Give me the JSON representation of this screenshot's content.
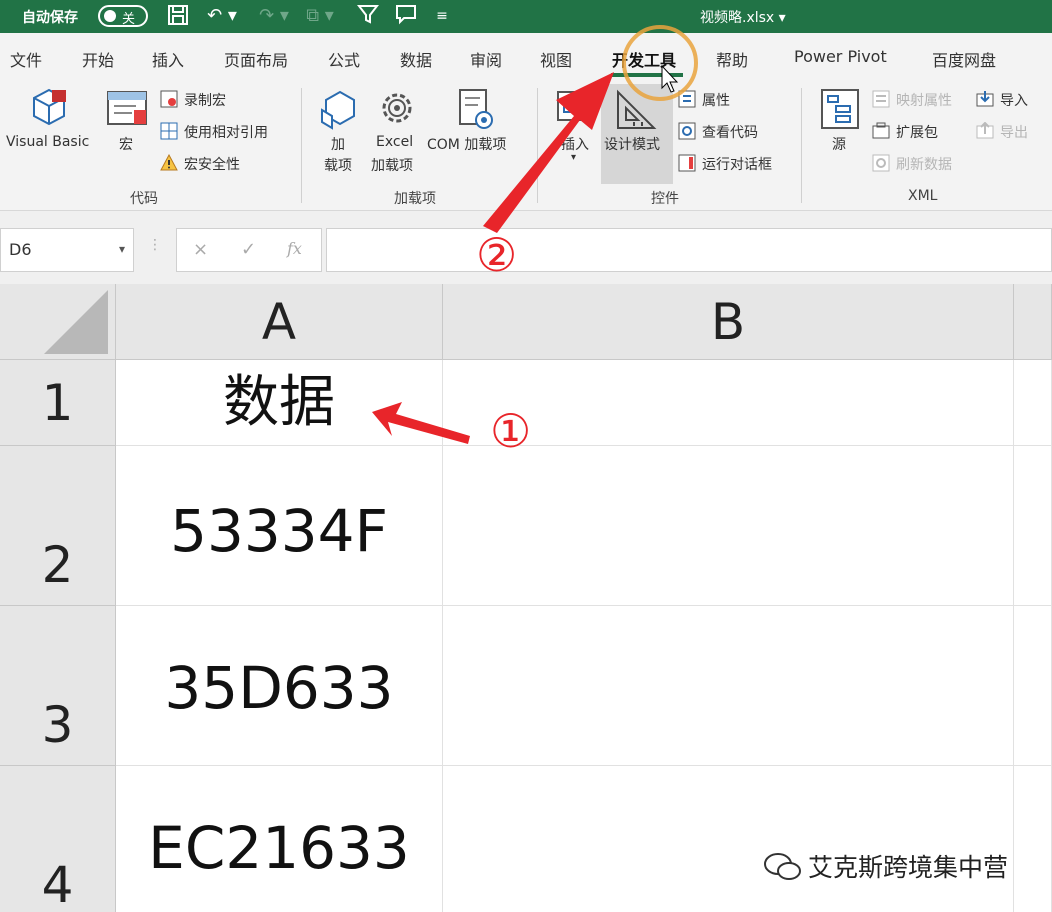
{
  "titlebar": {
    "autosave_label": "自动保存",
    "autosave_state": "关",
    "filename": "视频略.xlsx ▾",
    "bg_color": "#217346"
  },
  "ribbon_tabs": [
    "文件",
    "开始",
    "插入",
    "页面布局",
    "公式",
    "数据",
    "审阅",
    "视图",
    "开发工具",
    "帮助",
    "Power Pivot",
    "百度网盘"
  ],
  "active_tab": "开发工具",
  "code_group": {
    "label": "代码",
    "visual_basic": "Visual Basic",
    "macros": "宏",
    "record_macro": "录制宏",
    "use_relative": "使用相对引用",
    "macro_security": "宏安全性"
  },
  "addins_group": {
    "label": "加载项",
    "addins_line1": "加",
    "addins_line2": "载项",
    "excel_addins_line1": "Excel",
    "excel_addins_line2": "加载项",
    "com_addins": "COM 加载项"
  },
  "controls_group": {
    "label": "控件",
    "insert": "插入",
    "design_mode": "设计模式",
    "properties": "属性",
    "view_code": "查看代码",
    "run_dialog": "运行对话框"
  },
  "xml_group": {
    "label": "XML",
    "source": "源",
    "map_properties": "映射属性",
    "expansion_packs": "扩展包",
    "refresh_data": "刷新数据",
    "import": "导入",
    "export": "导出"
  },
  "formula_bar": {
    "name_box": "D6",
    "cancel_icon": "×",
    "enter_icon": "✓",
    "fx": "fx",
    "formula": ""
  },
  "sheet": {
    "columns": [
      "A",
      "B"
    ],
    "rows": [
      {
        "row": "1",
        "A": "数据",
        "B": ""
      },
      {
        "row": "2",
        "A": "53334F",
        "B": ""
      },
      {
        "row": "3",
        "A": "35D633",
        "B": ""
      },
      {
        "row": "4",
        "A": "EC21633",
        "B": ""
      }
    ]
  },
  "annotations": {
    "step1": "①",
    "step2": "②",
    "arrow_color": "#e8252a"
  },
  "watermark": "艾克斯跨境集中营"
}
